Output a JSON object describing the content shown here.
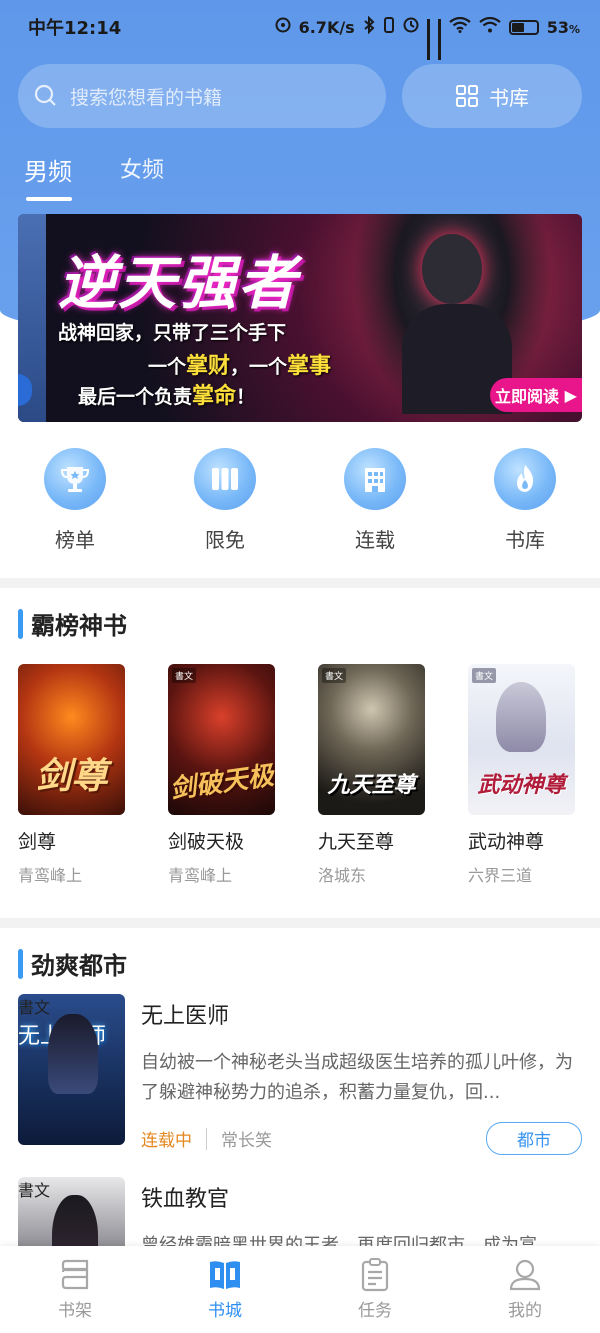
{
  "status_bar": {
    "time": "中午12:14",
    "net_speed": "6.7K/s",
    "battery": "53",
    "battery_unit": "%"
  },
  "search": {
    "placeholder": "搜索您想看的书籍",
    "library_label": "书库"
  },
  "gender_tabs": [
    {
      "label": "男频",
      "active": true
    },
    {
      "label": "女频",
      "active": false
    }
  ],
  "banner": {
    "title": "逆天强者",
    "line1": "战神回家，只带了三个手下",
    "line2_a": "一个",
    "line2_b": "掌财",
    "line2_c": "，一个",
    "line2_d": "掌事",
    "line3_a": "最后一个负责",
    "line3_b": "掌命",
    "line3_c": "！",
    "cta": "立即阅读"
  },
  "quick_nav": [
    {
      "label": "榜单",
      "icon": "trophy-icon"
    },
    {
      "label": "限免",
      "icon": "book-stack-icon"
    },
    {
      "label": "连载",
      "icon": "building-icon"
    },
    {
      "label": "书库",
      "icon": "flame-icon"
    }
  ],
  "section_bangbang": {
    "title": "霸榜神书",
    "books": [
      {
        "title": "剑尊",
        "author": "青鸾峰上",
        "cover_text": "剑尊"
      },
      {
        "title": "剑破天极",
        "author": "青鸾峰上",
        "cover_text": "剑破天极"
      },
      {
        "title": "九天至尊",
        "author": "洛城东",
        "cover_text": "九天至尊"
      },
      {
        "title": "武动神尊",
        "author": "六界三道",
        "cover_text": "武动神尊"
      }
    ]
  },
  "section_dushi": {
    "title": "劲爽都市",
    "items": [
      {
        "title": "无上医师",
        "cover_text": "无上医师",
        "desc": "自幼被一个神秘老头当成超级医生培养的孤儿叶修，为了躲避神秘势力的追杀，积蓄力量复仇，回...",
        "status": "连载中",
        "author": "常长笑",
        "tag": "都市"
      },
      {
        "title": "铁血教官",
        "desc": "曾经雄霸暗黑世界的王者，再度回归都市，成为富"
      }
    ]
  },
  "bottom_nav": [
    {
      "label": "书架",
      "active": false
    },
    {
      "label": "书城",
      "active": true
    },
    {
      "label": "任务",
      "active": false
    },
    {
      "label": "我的",
      "active": false
    }
  ],
  "colors": {
    "header_blue": "#5f98ea",
    "accent_blue": "#2f8ff0",
    "status_orange": "#e3871f"
  }
}
